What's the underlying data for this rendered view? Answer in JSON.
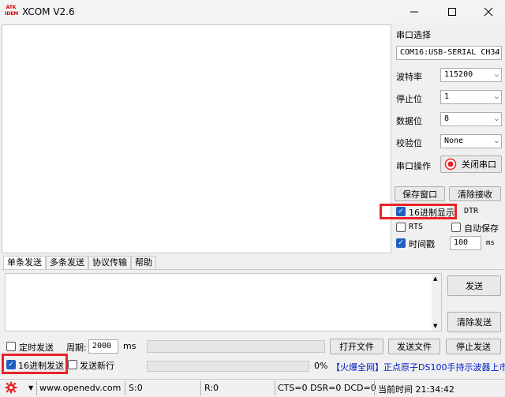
{
  "window": {
    "title": "XCOM V2.6",
    "logo_text": "ATK IDEM"
  },
  "panel": {
    "port_select_label": "串口选择",
    "port_value": "COM16:USB-SERIAL CH34",
    "baud_label": "波特率",
    "baud_value": "115200",
    "stop_label": "停止位",
    "stop_value": "1",
    "data_label": "数据位",
    "data_value": "8",
    "parity_label": "校验位",
    "parity_value": "None",
    "port_op_label": "串口操作",
    "close_port_button": "关闭串口",
    "save_window_button": "保存窗口",
    "clear_recv_button": "清除接收",
    "hex_display_label": "16进制显示",
    "hex_display_checked": true,
    "dtr_label": "DTR",
    "rts_label": "RTS",
    "auto_save_label": "自动保存",
    "timestamp_label": "时间戳",
    "timestamp_checked": true,
    "timestamp_value": "100",
    "timestamp_unit": "ms"
  },
  "tabs": [
    "单条发送",
    "多条发送",
    "协议传输",
    "帮助"
  ],
  "send": {
    "send_button": "发送",
    "clear_send_button": "清除发送",
    "timed_send_label": "定时发送",
    "period_label": "周期:",
    "period_value": "2000",
    "period_unit": "ms",
    "open_file_button": "打开文件",
    "send_file_button": "发送文件",
    "stop_send_button": "停止发送",
    "hex_send_label": "16进制发送",
    "hex_send_checked": true,
    "newline_label": "发送新行",
    "progress_text": "0%",
    "progress_fraction": 0,
    "ad_text": "【火爆全网】正点原子DS100手持示波器上市"
  },
  "status": {
    "website": "www.openedv.com",
    "s_count": "S:0",
    "r_count": "R:0",
    "lines": "CTS=0 DSR=0 DCD=0",
    "time": "当前时间 21:34:42"
  },
  "colors": {
    "accent": "#1f5fbf",
    "highlight": "#e8242a",
    "ad": "#0020c8"
  }
}
